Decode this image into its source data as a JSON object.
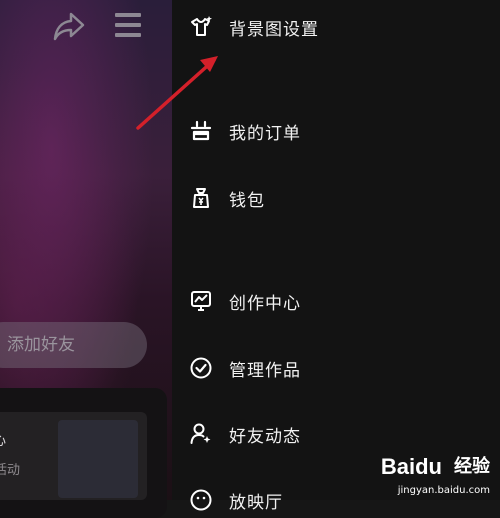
{
  "left_panel": {
    "add_friend_label": "添加好友",
    "card_line1": "心",
    "card_line2": "活动"
  },
  "drawer": {
    "items": [
      {
        "label": "背景图设置",
        "icon": "tshirt-icon"
      },
      {
        "label": "我的订单",
        "icon": "orders-icon"
      },
      {
        "label": "钱包",
        "icon": "wallet-icon"
      },
      {
        "label": "创作中心",
        "icon": "creator-center-icon"
      },
      {
        "label": "管理作品",
        "icon": "check-circle-icon"
      },
      {
        "label": "好友动态",
        "icon": "friend-activity-icon"
      },
      {
        "label": "放映厅",
        "icon": "smiley-icon"
      }
    ]
  },
  "annotation": {
    "arrow_color": "#d4202a"
  },
  "watermark": {
    "brand": "Baidu",
    "brand_cn": "经验",
    "url": "jingyan.baidu.com"
  }
}
